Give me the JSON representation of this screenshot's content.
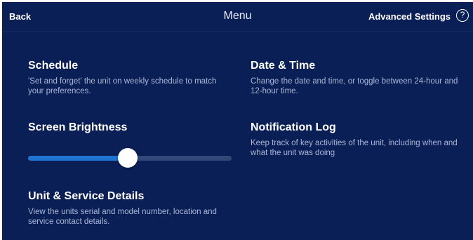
{
  "header": {
    "back_label": "Back",
    "title": "Menu",
    "advanced_label": "Advanced Settings",
    "help_glyph": "?"
  },
  "schedule": {
    "title": "Schedule",
    "description": "'Set and forget' the unit on weekly schedule to match your preferences."
  },
  "date_time": {
    "title": "Date & Time",
    "description": "Change the date and time, or toggle between 24-hour and 12-hour time."
  },
  "brightness": {
    "title": "Screen Brightness",
    "level": 0.49
  },
  "notification_log": {
    "title": "Notification Log",
    "description": "Keep track of key activities of the unit, including when and what the unit was doing"
  },
  "unit_service": {
    "title": "Unit & Service Details",
    "description": "View the units serial and model number, location and service contact details."
  },
  "colors": {
    "background": "#0b1f57",
    "accent": "#1f73d2",
    "track": "#324879",
    "muted_text": "#a9b6d6"
  }
}
